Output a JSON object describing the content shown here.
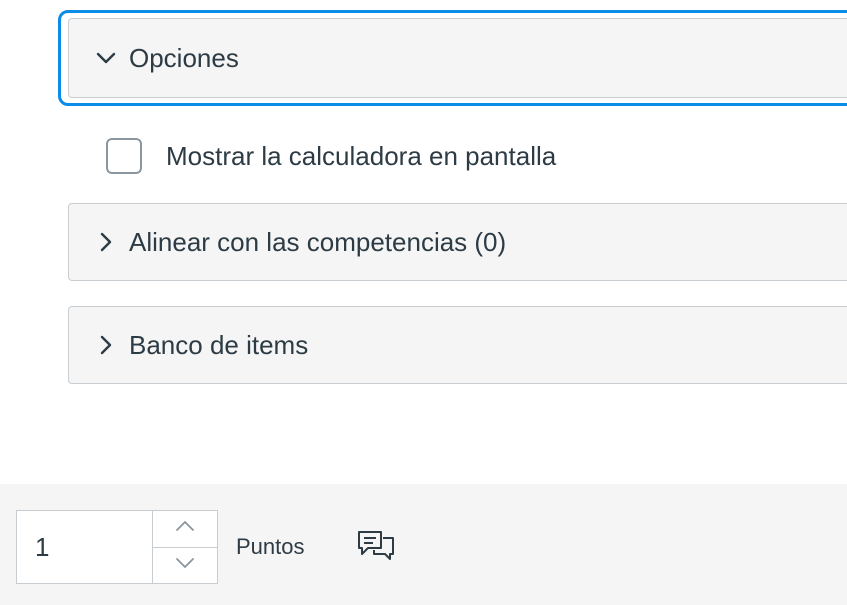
{
  "options_panel": {
    "label": "Opciones",
    "expanded": true
  },
  "calculator_checkbox": {
    "label": "Mostrar la calculadora en pantalla",
    "checked": false
  },
  "align_panel": {
    "label": "Alinear con las competencias (0)"
  },
  "item_bank_panel": {
    "label": "Banco de items"
  },
  "points": {
    "value": "1",
    "label": "Puntos"
  },
  "icons": {
    "options_toggle": "chevron-down-icon",
    "align_toggle": "chevron-right-icon",
    "bank_toggle": "chevron-right-icon",
    "increment": "chevron-up-icon",
    "decrement": "chevron-down-icon",
    "feedback": "comment-icon"
  },
  "colors": {
    "focus": "#0b8ce9",
    "panel_bg": "#f5f5f5",
    "border": "#c7cdd1",
    "text": "#2d3b45"
  }
}
